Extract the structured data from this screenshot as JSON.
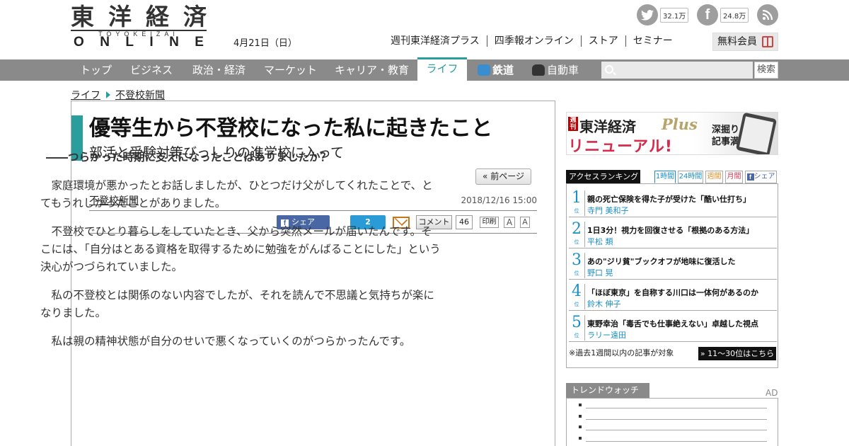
{
  "header": {
    "logo_kanji": [
      "東",
      "洋",
      "経",
      "済"
    ],
    "logo_sub": "TOYOKEIZAI",
    "logo_online": [
      "O",
      "N",
      "L",
      "I",
      "N",
      "E"
    ],
    "date": "4月21日（日）",
    "twitter_count": "32.1万",
    "facebook_count": "24.8万",
    "topnav": [
      "週刊東洋経済プラス",
      "四季報オンライン",
      "ストア",
      "セミナー"
    ],
    "member_label": "無料会員"
  },
  "mainnav": {
    "items": [
      "トップ",
      "ビジネス",
      "政治・経済",
      "マーケット",
      "キャリア・教育",
      "ライフ",
      "鉄道",
      "自動車"
    ],
    "active": "ライフ",
    "search_placeholder": "",
    "search_button": "検索"
  },
  "breadcrumb": [
    "ライフ",
    "不登校新聞"
  ],
  "article": {
    "title": "優等生から不登校になった私に起きたこと",
    "subtitle": "部活と受験対策びっしりの進学校に入って",
    "prev_page": "« 前ページ",
    "series": "不登校新聞",
    "pubdate": "2018/12/16 15:00",
    "share_label": "シェア",
    "hatena_count": "2",
    "comment_label": "コメント",
    "comment_count": "46",
    "print_label": "印刷",
    "font_large": "A",
    "font_small": "A",
    "question": "――つらかった時期に支えになったことはありましたか？",
    "paragraphs": [
      "家庭環境が悪かったとお話しましたが、ひとつだけ父がしてくれたことで、とてもうれしかったことがありました。",
      "不登校でひとり暮らしをしていたとき、父から突然メールが届いたんです。そこには、「自分はとある資格を取得するために勉強をがんばることにした」という決心がつづられていました。",
      "私の不登校とは関係のない内容でしたが、それを読んで不思議と気持ちが楽になりました。",
      "私は親の精神状態が自分のせいで悪くなっていくのがつらかったんです。"
    ]
  },
  "sidebar": {
    "banner": {
      "weekly": "週刊",
      "brand": "東洋経済",
      "plus": "Plus",
      "renewal": "リニューアル!",
      "tagline_1": "深掘り",
      "tagline_2": "記事満載"
    },
    "ranking": {
      "title": "アクセスランキング",
      "tabs": [
        "1時間",
        "24時間",
        "週間",
        "月間",
        "シェア"
      ],
      "items": [
        {
          "num": "1",
          "suffix": "位",
          "title": "親の死亡保険を得た子が受けた「酷い仕打ち」",
          "author": "寺門 美和子"
        },
        {
          "num": "2",
          "suffix": "位",
          "title": "1日3分！視力を回復させる「根拠のある方法」",
          "author": "平松 類"
        },
        {
          "num": "3",
          "suffix": "位",
          "title": "あの\"ジリ貧\"ブックオフが地味に復活した",
          "author": "野口 晃"
        },
        {
          "num": "4",
          "suffix": "位",
          "title": "「ほぼ東京」を自称する川口は一体何があるのか",
          "author": "鈴木 伸子"
        },
        {
          "num": "5",
          "suffix": "位",
          "title": "東野幸治「毒舌でも仕事絶えない」卓越した視点",
          "author": "ラリー遠田"
        }
      ],
      "note": "※過去1週間以内の記事が対象",
      "more": "» 11～30位はこちら"
    },
    "trend": {
      "title": "トレンドウォッチ",
      "ad": "AD"
    }
  },
  "colors": {
    "teal": "#2a9d9d",
    "nav_gray": "#8a8a8a",
    "rank_blue": "#1a8fc9",
    "facebook": "#4a67a5",
    "hatena": "#2a9bd6"
  }
}
